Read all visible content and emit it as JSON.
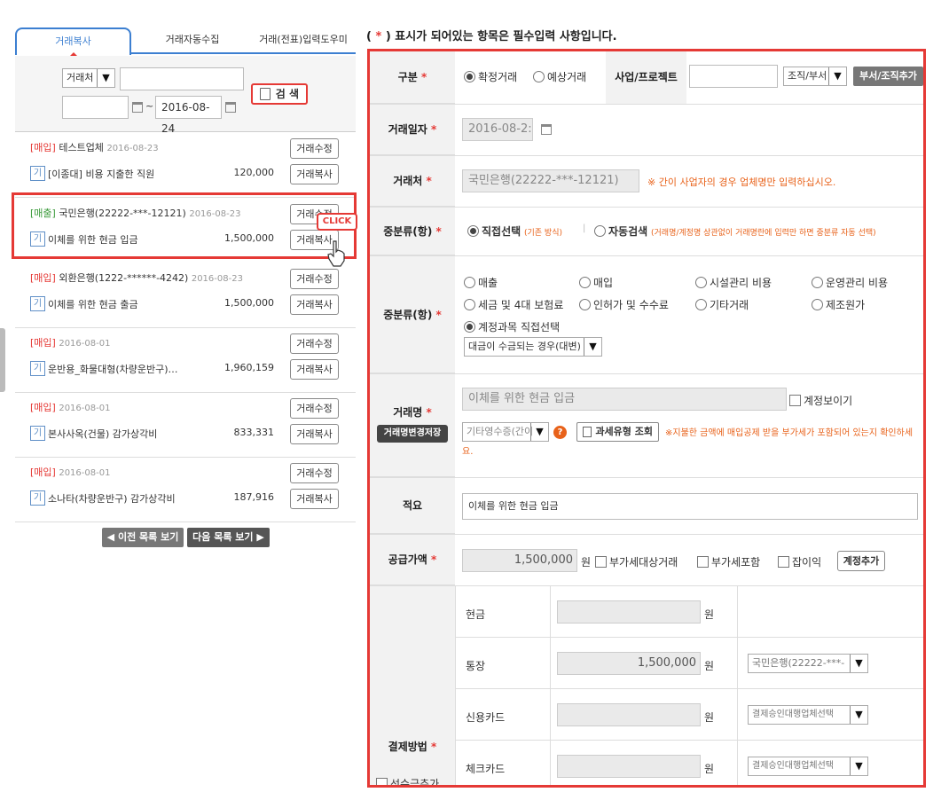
{
  "tabs": [
    "거래복사",
    "거래자동수집",
    "거래(전표)입력도우미"
  ],
  "search": {
    "type_option": "거래처",
    "date_to": "2016-08-24",
    "button": "검 색"
  },
  "list": [
    {
      "tag": "[매입]",
      "title": "테스트업체",
      "date": "2016-08-23",
      "desc": "[이종대] 비용 지출한 직원",
      "amount": "120,000",
      "kind": "buy"
    },
    {
      "tag": "[매출]",
      "title": "국민은행(22222-***-12121)",
      "date": "2016-08-23",
      "desc": "이체를 위한 현금 입금",
      "amount": "1,500,000",
      "kind": "sale"
    },
    {
      "tag": "[매입]",
      "title": "외환은행(1222-******-4242)",
      "date": "2016-08-23",
      "desc": "이체를 위한 현금 출금",
      "amount": "1,500,000",
      "kind": "buy"
    },
    {
      "tag": "[매입]",
      "title": "",
      "date": "2016-08-01",
      "desc": "운반용_화물대형(차량운반구)…",
      "amount": "1,960,159",
      "kind": "buy"
    },
    {
      "tag": "[매입]",
      "title": "",
      "date": "2016-08-01",
      "desc": "본사사옥(건물) 감가상각비",
      "amount": "833,331",
      "kind": "buy"
    },
    {
      "tag": "[매입]",
      "title": "",
      "date": "2016-08-01",
      "desc": "소나타(차량운반구) 감가상각비",
      "amount": "187,916",
      "kind": "buy"
    }
  ],
  "list_labels": {
    "k": "기",
    "edit": "거래수정",
    "copy": "거래복사",
    "click": "CLICK"
  },
  "nav": {
    "prev": "◀ 이전 목록 보기",
    "next": "다음 목록 보기 ▶"
  },
  "notice": {
    "open": "(",
    "star": "*",
    "text": ") 표시가 되어있는 항목은 필수입력 사항입니다."
  },
  "form": {
    "star": "*",
    "gubun": {
      "label": "구분",
      "opt1": "확정거래",
      "opt2": "예상거래",
      "project_label": "사업/프로젝트",
      "org_option": "조직/부서",
      "org_button": "부서/조직추가"
    },
    "date": {
      "label": "거래일자",
      "value": "2016-08-2:"
    },
    "partner": {
      "label": "거래처",
      "value": "국민은행(22222-***-12121)",
      "hint": "※ 간이 사업자의 경우 업체명만 입력하십시오."
    },
    "class1": {
      "label": "중분류(항)",
      "opt1": "직접선택",
      "opt1_note": "(기존 방식)",
      "sep": "|",
      "opt2": "자동검색",
      "opt2_note": "(거래명/계정명 상관없이 거래명란에 입력만 하면 중분류 자동 선택)"
    },
    "class2": {
      "label": "중분류(항)",
      "options": [
        "매출",
        "매입",
        "시설관리 비용",
        "운영관리 비용",
        "세금 및 4대 보험료",
        "인허가 및 수수료",
        "기타거래",
        "제조원가",
        "계정과목 직접선택"
      ],
      "account_option": "대금이 수금되는 경우(대변)"
    },
    "name": {
      "label": "거래명",
      "value": "이체를 위한 현금 입금",
      "show_account": "계정보이기",
      "save_btn": "거래명변경저장",
      "evidence_option": "기타영수증(간이",
      "help": "?",
      "tax_btn": "과세유형 조회",
      "tax_hint": "※지불한 금액에 매입공제 받을 부가세가 포함되어 있는지 확인하세요."
    },
    "memo": {
      "label": "적요",
      "value": "이체를 위한 현금 입금"
    },
    "supply": {
      "label": "공급가액",
      "value": "1,500,000",
      "unit": "원",
      "chk1": "부가세대상거래",
      "chk2": "부가세포함",
      "chk3": "잡이익",
      "add_btn": "계정추가"
    },
    "payment": {
      "label": "결제방법",
      "advance": "선수금추가",
      "rows": [
        {
          "name": "현금",
          "value": "",
          "unit": "원",
          "select": ""
        },
        {
          "name": "통장",
          "value": "1,500,000",
          "unit": "원",
          "select": "국민은행(22222-***-"
        },
        {
          "name": "신용카드",
          "value": "",
          "unit": "원",
          "select": "결제승인대행업체선택"
        },
        {
          "name": "체크카드",
          "value": "",
          "unit": "원",
          "select": "결제승인대행업체선택"
        }
      ]
    }
  }
}
